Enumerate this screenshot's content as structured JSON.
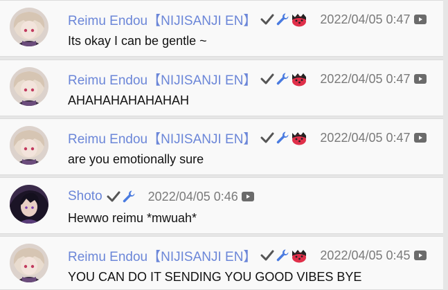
{
  "messages": [
    {
      "author": "Reimu Endou【NIJISANJI EN】",
      "badges": [
        "check-icon",
        "wrench-icon",
        "member-icon"
      ],
      "avatar": "reimu",
      "time": "2022/04/05 0:47",
      "text": "Its okay I can be gentle ~"
    },
    {
      "author": "Reimu Endou【NIJISANJI EN】",
      "badges": [
        "check-icon",
        "wrench-icon",
        "member-icon"
      ],
      "avatar": "reimu",
      "time": "2022/04/05 0:47",
      "text": "AHAHAHAHAHAHAH"
    },
    {
      "author": "Reimu Endou【NIJISANJI EN】",
      "badges": [
        "check-icon",
        "wrench-icon",
        "member-icon"
      ],
      "avatar": "reimu",
      "time": "2022/04/05 0:47",
      "text": "are you emotionally sure"
    },
    {
      "author": "Shoto",
      "badges": [
        "check-icon",
        "wrench-icon"
      ],
      "avatar": "shoto",
      "time": "2022/04/05 0:46",
      "text": "Hewwo reimu *mwuah*"
    },
    {
      "author": "Reimu Endou【NIJISANJI EN】",
      "badges": [
        "check-icon",
        "wrench-icon",
        "member-icon"
      ],
      "avatar": "reimu",
      "time": "2022/04/05 0:45",
      "text": "YOU CAN DO IT SENDING YOU GOOD VIBES BYE"
    }
  ],
  "colors": {
    "author": "#6b86d8",
    "wrench": "#4a7be0",
    "check": "#555555",
    "time": "#7a7a7a",
    "member_red": "#e0304a"
  }
}
